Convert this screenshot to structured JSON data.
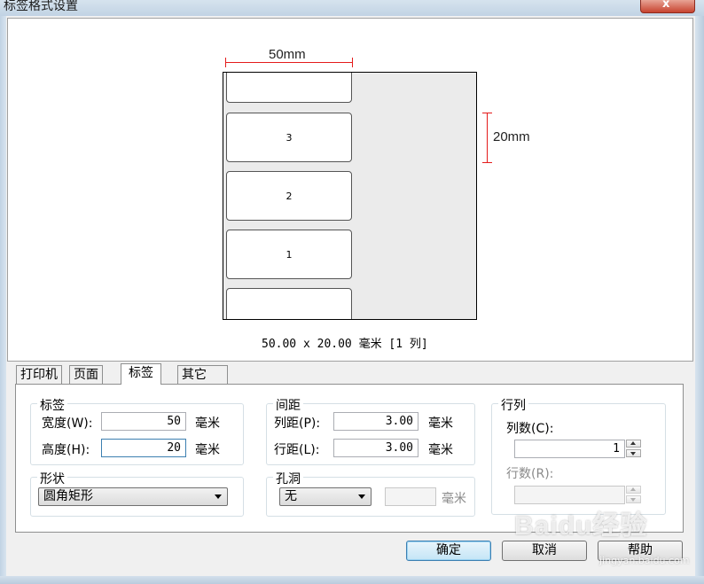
{
  "window": {
    "title": "标签格式设置",
    "close_label": "x"
  },
  "preview": {
    "width_dim": "50mm",
    "height_dim": "20mm",
    "labels": [
      "3",
      "2",
      "1"
    ],
    "size_text": "50.00 x 20.00 毫米 [1 列]"
  },
  "tabs": [
    "打印机",
    "页面",
    "标签",
    "其它"
  ],
  "label_group": {
    "title": "标签",
    "width_label": "宽度(W):",
    "width_value": "50",
    "height_label": "高度(H):",
    "height_value": "20",
    "unit": "毫米"
  },
  "spacing_group": {
    "title": "间距",
    "col_label": "列距(P):",
    "col_value": "3.00",
    "row_label": "行距(L):",
    "row_value": "3.00",
    "unit": "毫米"
  },
  "rowcol_group": {
    "title": "行列",
    "cols_label": "列数(C):",
    "cols_value": "1",
    "rows_label": "行数(R):",
    "rows_value": ""
  },
  "shape_group": {
    "title": "形状",
    "selected": "圆角矩形"
  },
  "hole_group": {
    "title": "孔洞",
    "selected": "无",
    "value": "",
    "unit": "毫米"
  },
  "buttons": {
    "ok": "确定",
    "cancel": "取消",
    "help": "帮助"
  },
  "watermark": {
    "text": "Baidu经验",
    "sub": "jingyan.baidu.com"
  }
}
